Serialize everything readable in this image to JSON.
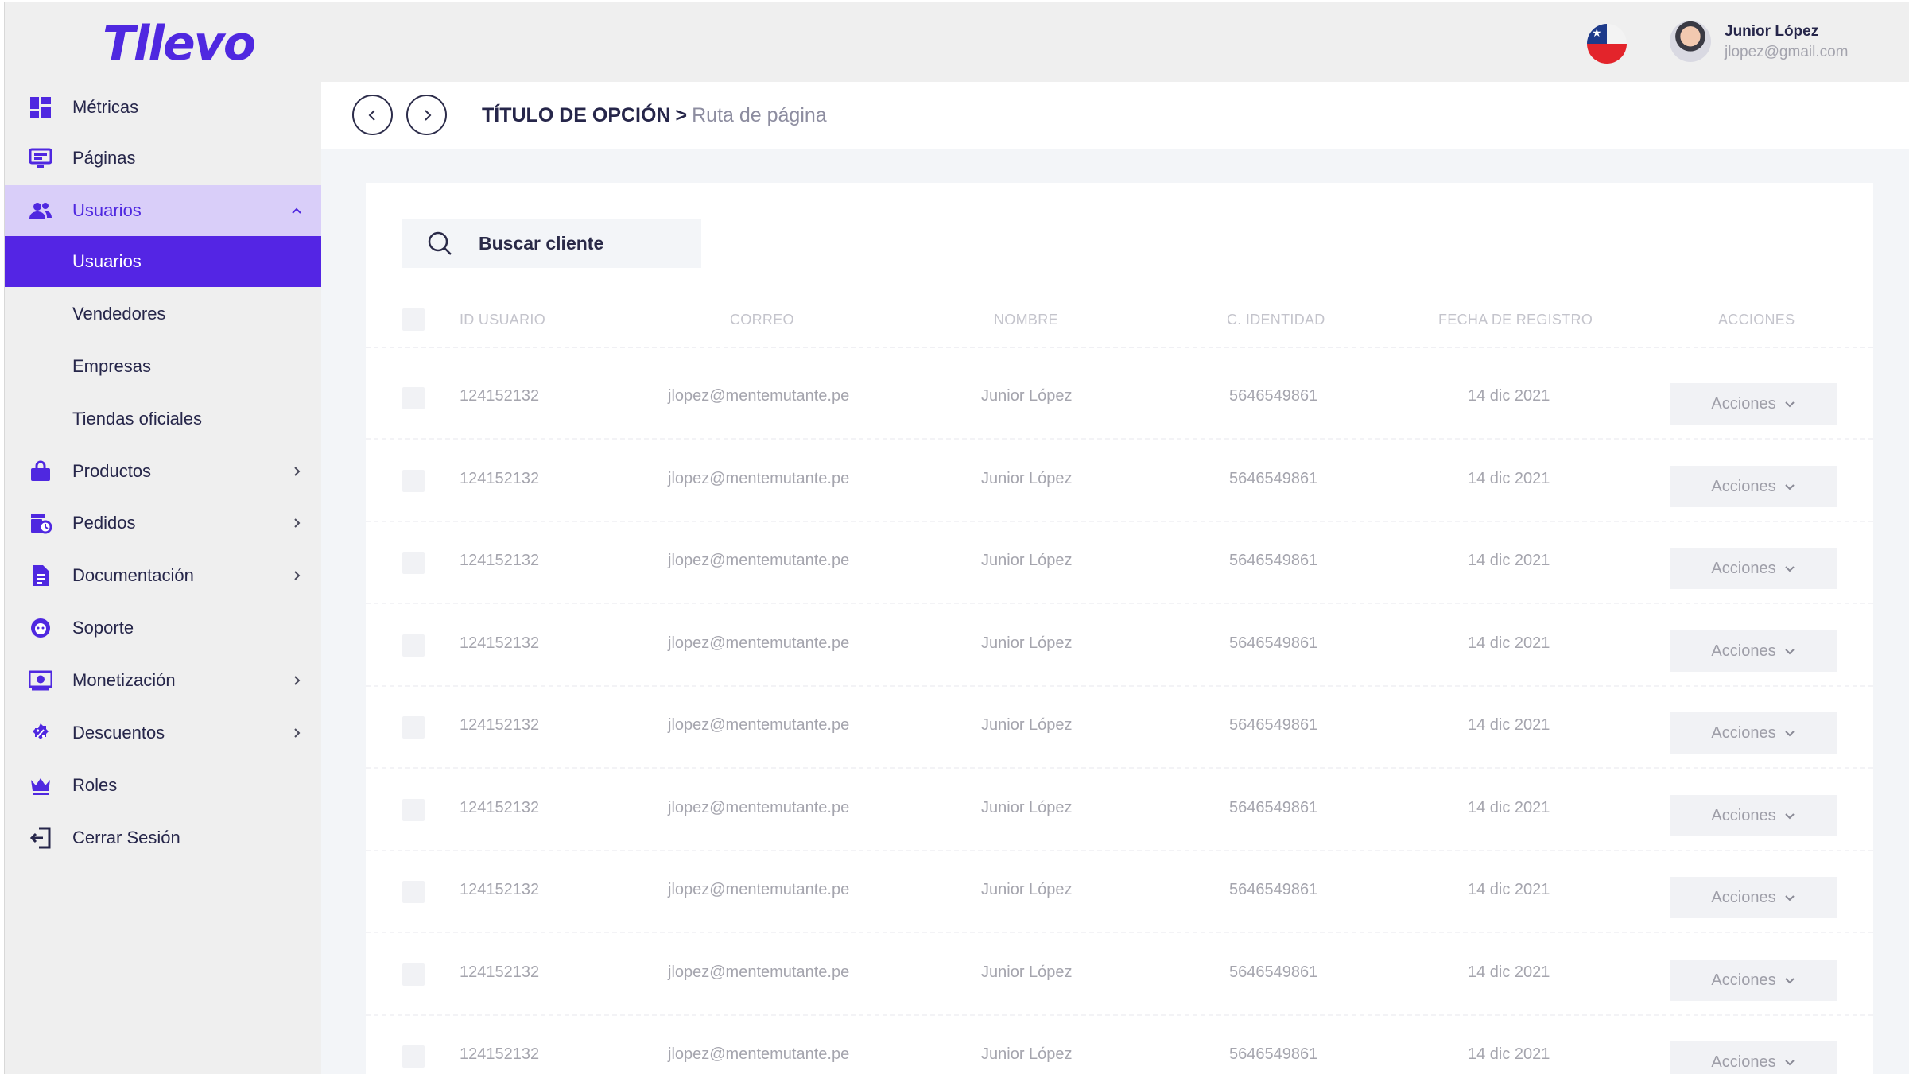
{
  "brand": {
    "logo_text": "Tllevo",
    "accent": "#5425e4",
    "accent_light": "#d9cef9"
  },
  "header": {
    "flag": "chile-flag-icon",
    "user": {
      "name": "Junior López",
      "email": "jlopez@gmail.com"
    }
  },
  "sidebar": {
    "items": [
      {
        "label": "Métricas",
        "icon": "dashboard-icon"
      },
      {
        "label": "Páginas",
        "icon": "monitor-icon"
      },
      {
        "label": "Usuarios",
        "icon": "users-icon",
        "expanded": true
      },
      {
        "label": "Usuarios",
        "sub": true,
        "active": true
      },
      {
        "label": "Vendedores",
        "sub": true
      },
      {
        "label": "Empresas",
        "sub": true
      },
      {
        "label": "Tiendas oficiales",
        "sub": true
      },
      {
        "label": "Productos",
        "icon": "bag-icon"
      },
      {
        "label": "Pedidos",
        "icon": "orders-icon"
      },
      {
        "label": "Documentación",
        "icon": "document-icon"
      },
      {
        "label": "Soporte",
        "icon": "support-icon"
      },
      {
        "label": "Monetización",
        "icon": "money-icon"
      },
      {
        "label": "Descuentos",
        "icon": "discount-icon"
      },
      {
        "label": "Roles",
        "icon": "crown-icon"
      },
      {
        "label": "Cerrar Sesión",
        "icon": "logout-icon"
      }
    ]
  },
  "breadcrumb": {
    "section": "TÍTULO DE OPCIÓN",
    "separator": ">",
    "current": "Ruta de página"
  },
  "search": {
    "placeholder": "Buscar cliente"
  },
  "table": {
    "columns": [
      "ID USUARIO",
      "CORREO",
      "NOMBRE",
      "C. IDENTIDAD",
      "FECHA DE REGISTRO",
      "ACCIONES"
    ],
    "rows": [
      {
        "id": "124152132",
        "email": "jlopez@mentemutante.pe",
        "name": "Junior López",
        "ci": "5646549861",
        "date": "14 dic 2021",
        "action": "Acciones"
      },
      {
        "id": "124152132",
        "email": "jlopez@mentemutante.pe",
        "name": "Junior López",
        "ci": "5646549861",
        "date": "14 dic 2021",
        "action": "Acciones"
      },
      {
        "id": "124152132",
        "email": "jlopez@mentemutante.pe",
        "name": "Junior López",
        "ci": "5646549861",
        "date": "14 dic 2021",
        "action": "Acciones"
      },
      {
        "id": "124152132",
        "email": "jlopez@mentemutante.pe",
        "name": "Junior López",
        "ci": "5646549861",
        "date": "14 dic 2021",
        "action": "Acciones"
      },
      {
        "id": "124152132",
        "email": "jlopez@mentemutante.pe",
        "name": "Junior López",
        "ci": "5646549861",
        "date": "14 dic 2021",
        "action": "Acciones"
      },
      {
        "id": "124152132",
        "email": "jlopez@mentemutante.pe",
        "name": "Junior López",
        "ci": "5646549861",
        "date": "14 dic 2021",
        "action": "Acciones"
      },
      {
        "id": "124152132",
        "email": "jlopez@mentemutante.pe",
        "name": "Junior López",
        "ci": "5646549861",
        "date": "14 dic 2021",
        "action": "Acciones"
      },
      {
        "id": "124152132",
        "email": "jlopez@mentemutante.pe",
        "name": "Junior López",
        "ci": "5646549861",
        "date": "14 dic 2021",
        "action": "Acciones"
      },
      {
        "id": "124152132",
        "email": "jlopez@mentemutante.pe",
        "name": "Junior López",
        "ci": "5646549861",
        "date": "14 dic 2021",
        "action": "Acciones"
      }
    ]
  }
}
